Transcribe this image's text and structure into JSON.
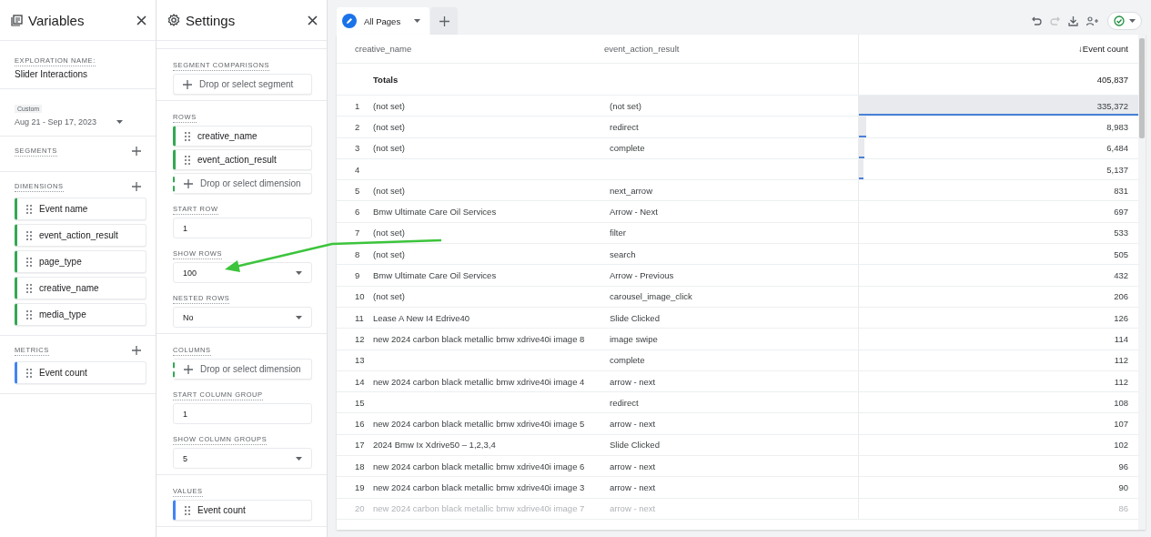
{
  "variables": {
    "title": "Variables",
    "exploration_label": "EXPLORATION NAME:",
    "exploration_name": "Slider Interactions",
    "date_label": "Custom",
    "date_range": "Aug 21 - Sep 17, 2023",
    "sections": [
      {
        "label": "SEGMENTS"
      },
      {
        "label": "DIMENSIONS",
        "items": [
          {
            "kind": "dimension",
            "text": "Event name"
          },
          {
            "kind": "dimension",
            "text": "event_action_result"
          },
          {
            "kind": "dimension",
            "text": "page_type"
          },
          {
            "kind": "dimension",
            "text": "creative_name"
          },
          {
            "kind": "dimension",
            "text": "media_type"
          }
        ]
      },
      {
        "label": "METRICS",
        "items": [
          {
            "kind": "metric",
            "text": "Event count"
          }
        ]
      }
    ]
  },
  "settings": {
    "title": "Settings",
    "groups": [
      [
        {
          "label": "SEGMENT COMPARISONS",
          "items": [
            {
              "kind": "drop",
              "text": "Drop or select segment"
            }
          ]
        }
      ],
      [
        {
          "label": "ROWS",
          "items": [
            {
              "kind": "dimension",
              "text": "creative_name"
            },
            {
              "kind": "dimension",
              "text": "event_action_result"
            },
            {
              "kind": "drop_dashed",
              "text": "Drop or select dimension"
            }
          ]
        },
        {
          "label": "START ROW",
          "items": [
            {
              "kind": "input",
              "text": "1"
            }
          ]
        },
        {
          "label": "SHOW ROWS",
          "items": [
            {
              "kind": "select",
              "text": "100"
            }
          ]
        },
        {
          "label": "NESTED ROWS",
          "items": [
            {
              "kind": "select",
              "text": "No"
            }
          ]
        }
      ],
      [
        {
          "label": "COLUMNS",
          "items": [
            {
              "kind": "drop_dashed",
              "text": "Drop or select dimension"
            }
          ]
        },
        {
          "label": "START COLUMN GROUP",
          "items": [
            {
              "kind": "input",
              "text": "1"
            }
          ]
        },
        {
          "label": "SHOW COLUMN GROUPS",
          "items": [
            {
              "kind": "select",
              "text": "5"
            }
          ]
        }
      ],
      [
        {
          "label": "VALUES",
          "items": [
            {
              "kind": "metric",
              "text": "Event count"
            }
          ]
        }
      ]
    ]
  },
  "tabs": [
    {
      "label": "All Pages",
      "selected": true
    }
  ],
  "toolbar": [
    {
      "kind": "undo",
      "disabled": false
    },
    {
      "kind": "redo",
      "disabled": true
    },
    {
      "kind": "download",
      "disabled": false
    },
    {
      "kind": "share",
      "disabled": false
    },
    {
      "kind": "status",
      "disabled": false
    }
  ],
  "table": {
    "columns": [
      "creative_name",
      "event_action_result",
      "↓Event count"
    ],
    "totals_label": "Totals",
    "totals_value": "405,837",
    "rows": [
      {
        "index": "1",
        "creative_name": "(not set)",
        "event_action_result": "(not set)",
        "event_count": "335,372",
        "level": 1,
        "dimmed": false
      },
      {
        "index": "2",
        "creative_name": "(not set)",
        "event_action_result": "redirect",
        "event_count": "8,983",
        "level": 0.027,
        "dimmed": false
      },
      {
        "index": "3",
        "creative_name": "(not set)",
        "event_action_result": "complete",
        "event_count": "6,484",
        "level": 0.019,
        "dimmed": false
      },
      {
        "index": "4",
        "creative_name": "",
        "event_action_result": "",
        "event_count": "5,137",
        "level": 0.015,
        "dimmed": false
      },
      {
        "index": "5",
        "creative_name": "(not set)",
        "event_action_result": "next_arrow",
        "event_count": "831",
        "dimmed": false
      },
      {
        "index": "6",
        "creative_name": "Bmw Ultimate Care Oil Services",
        "event_action_result": "Arrow - Next",
        "event_count": "697",
        "dimmed": false
      },
      {
        "index": "7",
        "creative_name": "(not set)",
        "event_action_result": "filter",
        "event_count": "533",
        "dimmed": false
      },
      {
        "index": "8",
        "creative_name": "(not set)",
        "event_action_result": "search",
        "event_count": "505",
        "dimmed": false
      },
      {
        "index": "9",
        "creative_name": "Bmw Ultimate Care Oil Services",
        "event_action_result": "Arrow - Previous",
        "event_count": "432",
        "dimmed": false
      },
      {
        "index": "10",
        "creative_name": "(not set)",
        "event_action_result": "carousel_image_click",
        "event_count": "206",
        "dimmed": false
      },
      {
        "index": "11",
        "creative_name": "Lease A New I4 Edrive40",
        "event_action_result": "Slide Clicked",
        "event_count": "126",
        "dimmed": false
      },
      {
        "index": "12",
        "creative_name": "new 2024 carbon black metallic bmw xdrive40i image 8",
        "event_action_result": "image swipe",
        "event_count": "114",
        "dimmed": false
      },
      {
        "index": "13",
        "creative_name": "",
        "event_action_result": "complete",
        "event_count": "112",
        "dimmed": false
      },
      {
        "index": "14",
        "creative_name": "new 2024 carbon black metallic bmw xdrive40i image 4",
        "event_action_result": "arrow - next",
        "event_count": "112",
        "dimmed": false
      },
      {
        "index": "15",
        "creative_name": "",
        "event_action_result": "redirect",
        "event_count": "108",
        "dimmed": false
      },
      {
        "index": "16",
        "creative_name": "new 2024 carbon black metallic bmw xdrive40i image 5",
        "event_action_result": "arrow - next",
        "event_count": "107",
        "dimmed": false
      },
      {
        "index": "17",
        "creative_name": "2024 Bmw Ix Xdrive50 – 1,2,3,4",
        "event_action_result": "Slide Clicked",
        "event_count": "102",
        "dimmed": false
      },
      {
        "index": "18",
        "creative_name": "new 2024 carbon black metallic bmw xdrive40i image 6",
        "event_action_result": "arrow - next",
        "event_count": "96",
        "dimmed": false
      },
      {
        "index": "19",
        "creative_name": "new 2024 carbon black metallic bmw xdrive40i image 3",
        "event_action_result": "arrow - next",
        "event_count": "90",
        "dimmed": false
      },
      {
        "index": "20",
        "creative_name": "new 2024 carbon black metallic bmw xdrive40i image 7",
        "event_action_result": "arrow - next",
        "event_count": "86",
        "dimmed": true
      }
    ]
  }
}
